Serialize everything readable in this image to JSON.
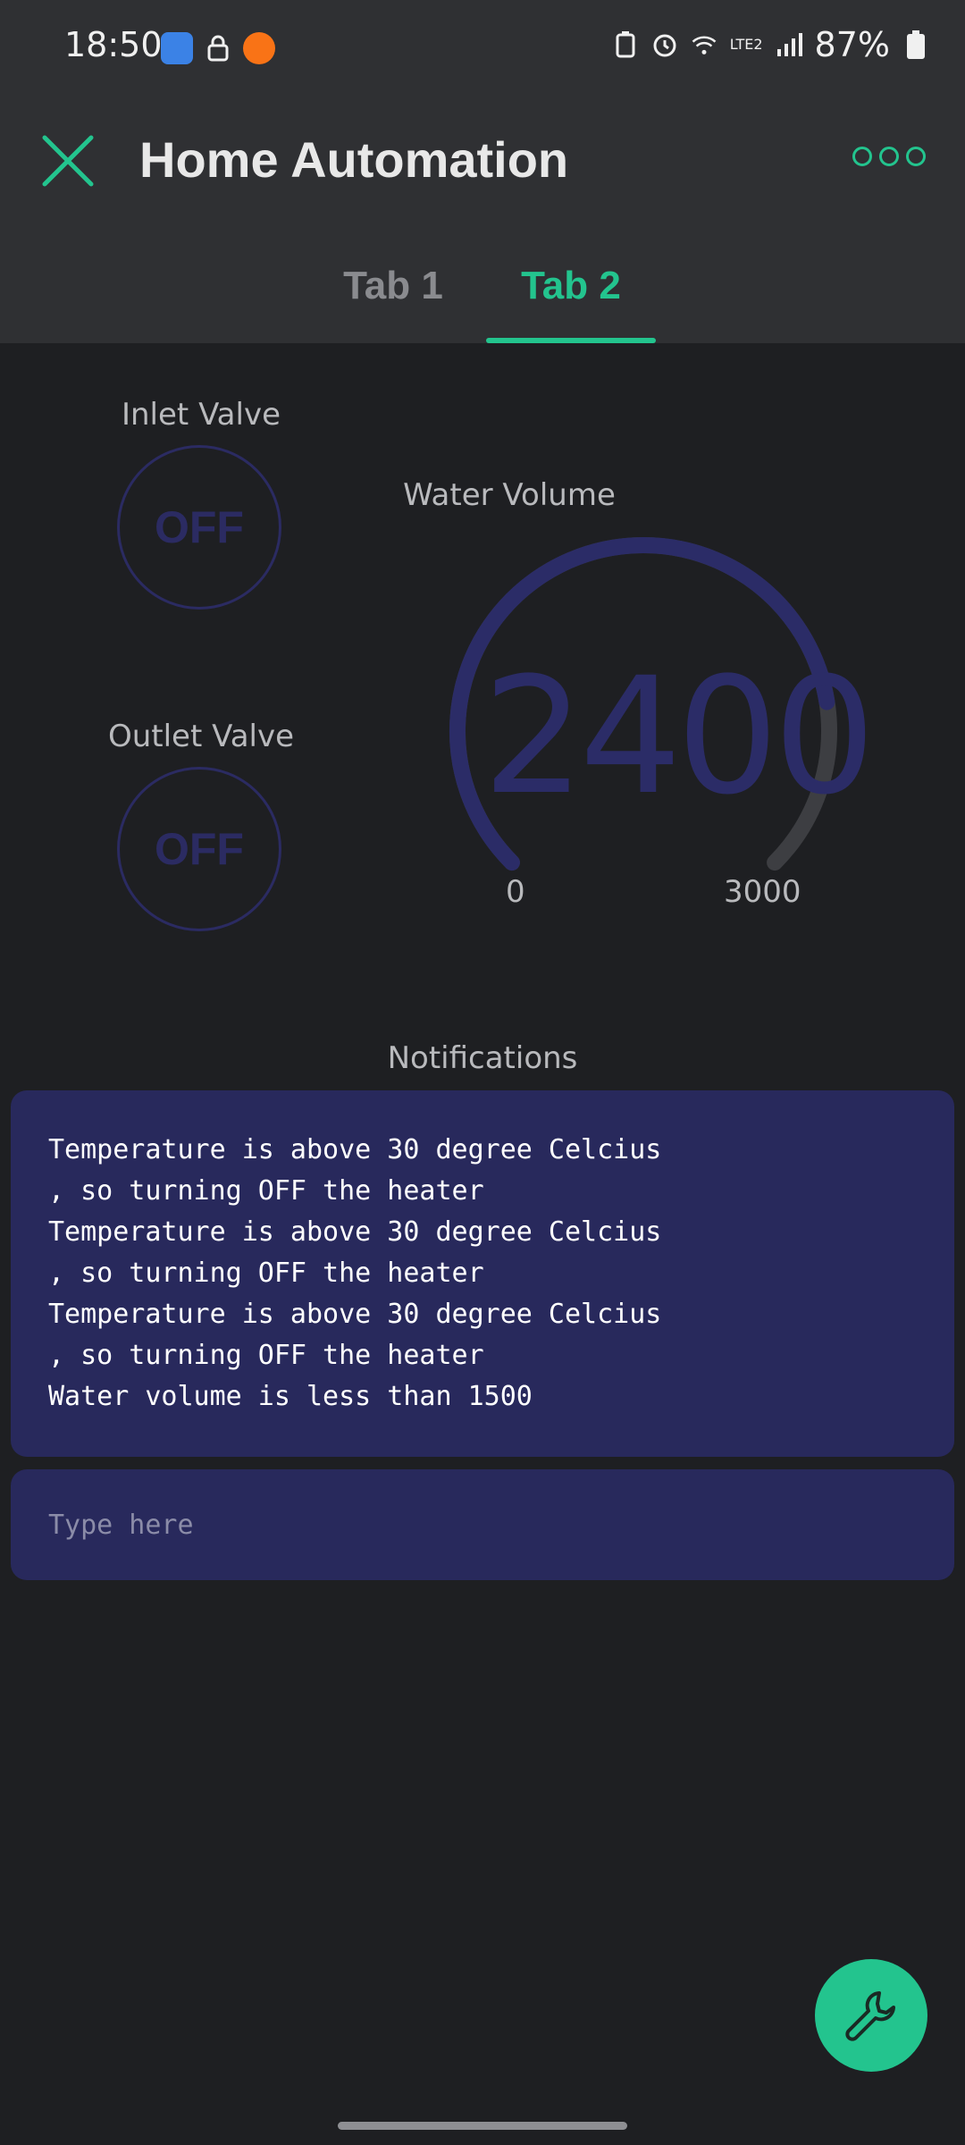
{
  "status_bar": {
    "time": "18:50",
    "battery": "87%",
    "network": "LTE2"
  },
  "app_bar": {
    "title": "Home Automation",
    "close_icon": "close-icon",
    "menu_icon": "more-dots-icon",
    "accent_color": "#23c48e"
  },
  "tabs": [
    {
      "label": "Tab 1",
      "active": false
    },
    {
      "label": "Tab 2",
      "active": true
    }
  ],
  "inlet_valve": {
    "label": "Inlet Valve",
    "state": "OFF"
  },
  "outlet_valve": {
    "label": "Outlet Valve",
    "state": "OFF"
  },
  "gauge": {
    "label": "Water Volume",
    "value": "2400",
    "min": "0",
    "max": "3000",
    "fill_fraction": 0.8,
    "fill_color": "#2b2c67",
    "track_color": "#3d3e42"
  },
  "notifications": {
    "label": "Notifications",
    "lines": [
      "Temperature is above 30 degree Celcius",
      ", so turning OFF the heater",
      "Temperature is above 30 degree Celcius",
      ", so turning OFF the heater",
      "Temperature is above 30 degree Celcius",
      ", so turning OFF the heater",
      "Water volume is less than 1500"
    ],
    "input_placeholder": "Type here"
  },
  "fab": {
    "icon": "wrench-icon"
  }
}
